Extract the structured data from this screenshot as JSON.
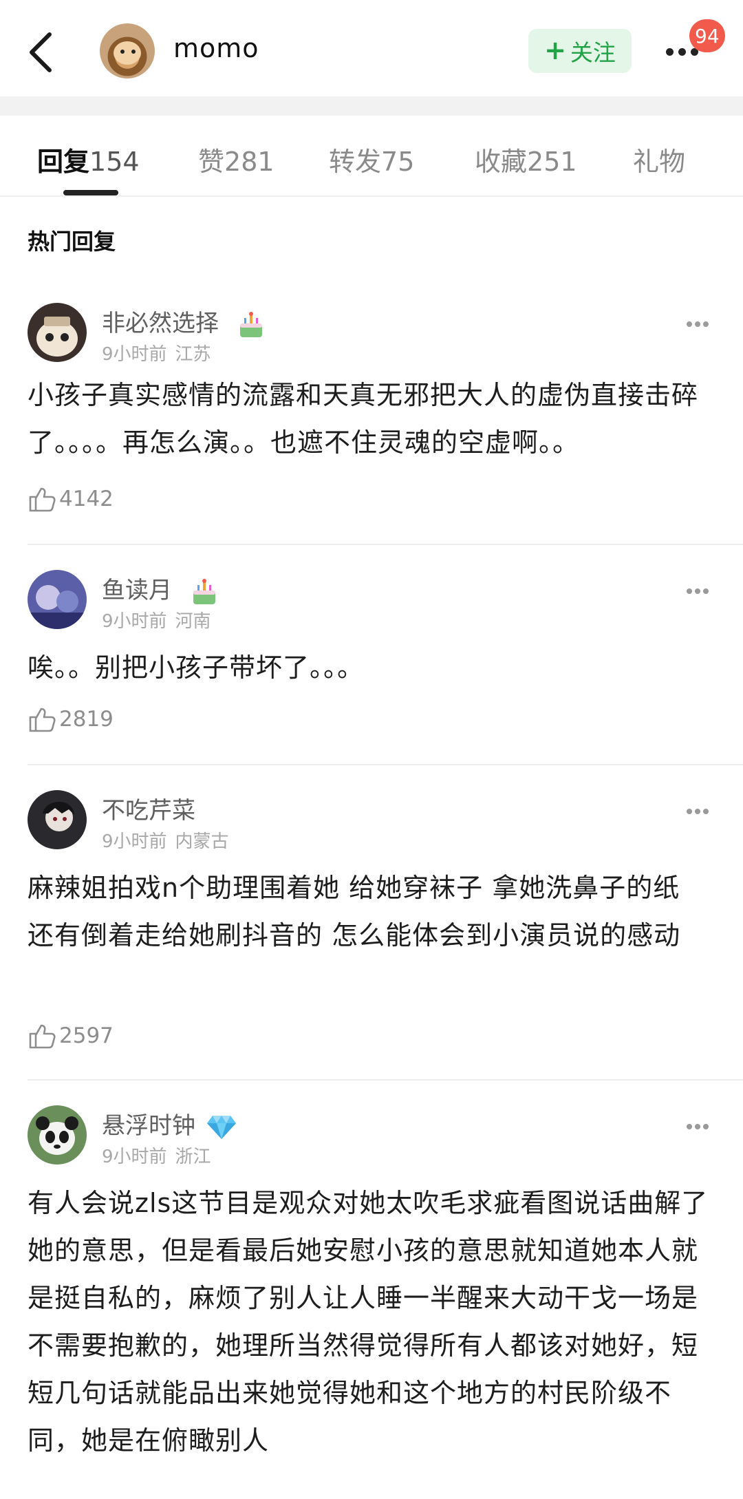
{
  "header": {
    "username": "momo",
    "follow_label": "关注",
    "follow_plus": "+",
    "badge_count": "94"
  },
  "tabs": [
    {
      "label": "回复",
      "count": "154",
      "active": true
    },
    {
      "label": "赞",
      "count": "281"
    },
    {
      "label": "转发",
      "count": "75"
    },
    {
      "label": "收藏",
      "count": "251"
    },
    {
      "label": "礼物",
      "count": ""
    }
  ],
  "section_title": "热门回复",
  "comments": [
    {
      "name": "非必然选择",
      "time": "9小时前",
      "location": "江苏",
      "badge_icon": "cake-icon",
      "text": "小孩子真实感情的流露和天真无邪把大人的虚伪直接击碎了。。。。再怎么演。。也遮不住灵魂的空虚啊。。",
      "likes": "4142"
    },
    {
      "name": "鱼读月",
      "time": "9小时前",
      "location": "河南",
      "badge_icon": "cake-icon",
      "text": "唉。。别把小孩子带坏了。。。",
      "likes": "2819"
    },
    {
      "name": "不吃芹菜",
      "time": "9小时前",
      "location": "内蒙古",
      "text": "麻辣姐拍戏n个助理围着她 给她穿袜子 拿她洗鼻子的纸 还有倒着走给她刷抖音的 怎么能体会到小演员说的感动",
      "likes": "2597"
    },
    {
      "name": "悬浮时钟",
      "time": "9小时前",
      "location": "浙江",
      "badge_icon": "diamond-icon",
      "text": "有人会说zls这节目是观众对她太吹毛求疵看图说话曲解了她的意思，但是看最后她安慰小孩的意思就知道她本人就是挺自私的，麻烦了别人让人睡一半醒来大动干戈一场是不需要抱歉的，她理所当然得觉得所有人都该对她好，短短几句话就能品出来她觉得她和这个地方的村民阶级不同，她是在俯瞰别人",
      "likes": ""
    }
  ],
  "colors": {
    "follow_bg": "#e4f6e8",
    "follow_text": "#22a348",
    "badge": "#f25a4b",
    "meta": "#a8a8a8"
  }
}
